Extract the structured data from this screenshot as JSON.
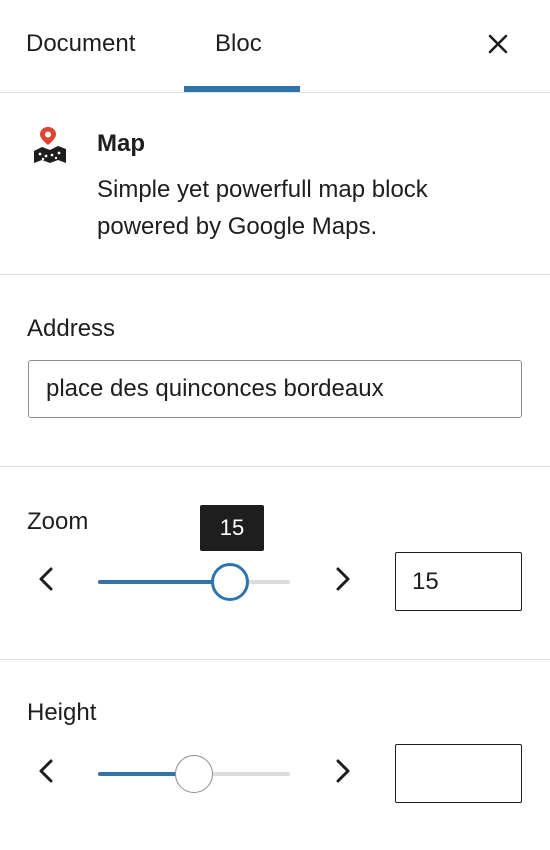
{
  "tabs": [
    {
      "label": "Document"
    },
    {
      "label": "Bloc"
    }
  ],
  "block": {
    "title": "Map",
    "description": "Simple yet powerfull map block powered by Google Maps.",
    "icon": "map-marker-icon",
    "icon_accent": "#e0432f"
  },
  "address": {
    "label": "Address",
    "value": "place des quinconces bordeaux",
    "placeholder": ""
  },
  "zoom": {
    "label": "Zoom",
    "value": "15",
    "tooltip": "15",
    "level_fraction": 0.69
  },
  "height": {
    "label": "Height",
    "value": "",
    "level_fraction": 0.5
  },
  "colors": {
    "accent": "#2f74ad",
    "text": "#1e1e1e",
    "divider": "#e0e0e0"
  }
}
